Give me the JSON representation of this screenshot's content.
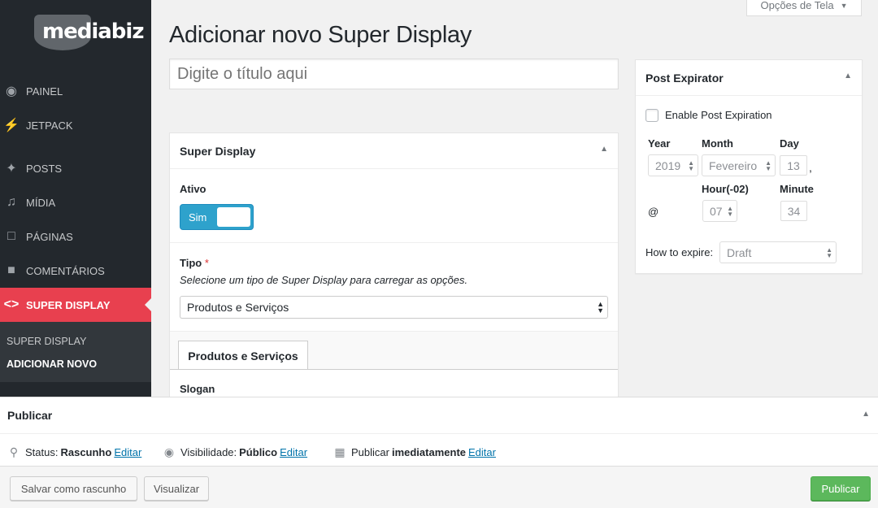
{
  "sidebar": {
    "logo": "mediabiz",
    "items": [
      {
        "label": "Painel",
        "icon": "palette-icon"
      },
      {
        "label": "Jetpack",
        "icon": "jetpack-icon"
      },
      {
        "label": "Posts",
        "icon": "pushpin-icon"
      },
      {
        "label": "Mídia",
        "icon": "media-icon"
      },
      {
        "label": "Páginas",
        "icon": "pages-icon"
      },
      {
        "label": "Comentários",
        "icon": "comment-icon"
      },
      {
        "label": "Super Display",
        "icon": "code-icon"
      }
    ],
    "submenu": [
      "Super Display",
      "Adicionar novo"
    ]
  },
  "header": {
    "screen_options": "Opções de Tela",
    "page_title": "Adicionar novo Super Display"
  },
  "title_input": {
    "placeholder": "Digite o título aqui"
  },
  "super_display_box": {
    "title": "Super Display",
    "ativo_label": "Ativo",
    "toggle_label": "Sim",
    "tipo_label": "Tipo",
    "required_mark": "*",
    "tipo_hint": "Selecione um tipo de Super Display para carregar as opções.",
    "tipo_selected": "Produtos e Serviços",
    "tab_label": "Produtos e Serviços",
    "slogan_label": "Slogan"
  },
  "post_expirator": {
    "title": "Post Expirator",
    "enable_label": "Enable Post Expiration",
    "year_label": "Year",
    "month_label": "Month",
    "day_label": "Day",
    "year_value": "2019",
    "month_value": "Fevereiro",
    "day_value": "13",
    "comma": ",",
    "at_symbol": "@",
    "hour_label": "Hour(-02)",
    "minute_label": "Minute",
    "hour_value": "07",
    "minute_value": "34",
    "how_label": "How to expire:",
    "how_value": "Draft"
  },
  "publish": {
    "title": "Publicar",
    "status_prefix": "Status:",
    "status_value": "Rascunho",
    "visibility_prefix": "Visibilidade:",
    "visibility_value": "Público",
    "schedule_prefix": "Publicar",
    "schedule_value": "imediatamente",
    "edit_link": "Editar",
    "save_draft": "Salvar como rascunho",
    "preview": "Visualizar",
    "publish_button": "Publicar"
  },
  "colors": {
    "sidebar": "#23282d",
    "active": "#e8404f",
    "toggle": "#2ea2cc",
    "publish": "#5cb85c",
    "link": "#0073aa"
  }
}
